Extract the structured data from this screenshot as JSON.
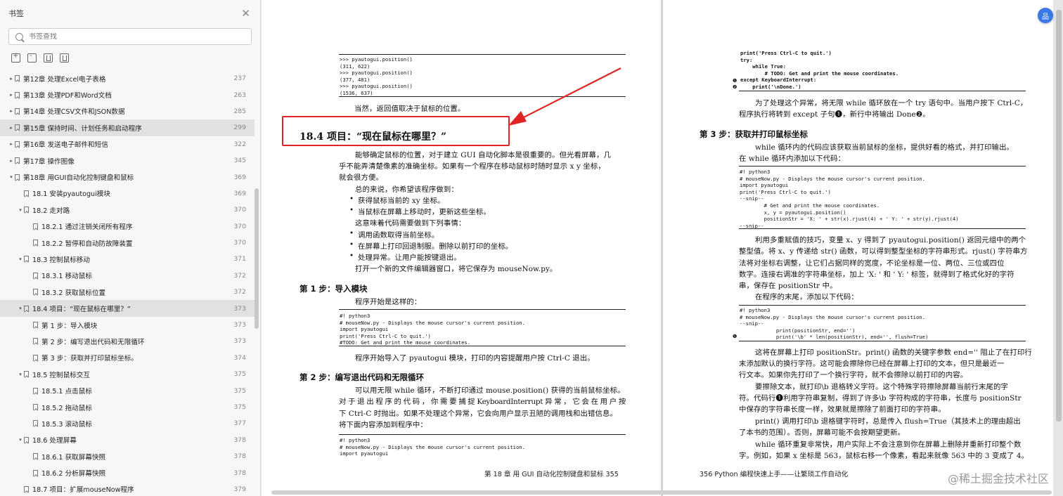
{
  "sidebar": {
    "title": "书签",
    "close_glyph": "✕",
    "search_placeholder": "书签查找",
    "items": [
      {
        "label": "第12章  处理Excel电子表格",
        "page": "237",
        "arrow": "▸"
      },
      {
        "label": "第13章  处理PDF和Word文档",
        "page": "263",
        "arrow": "▸"
      },
      {
        "label": "第14章  处理CSV文件和JSON数据",
        "page": "285",
        "arrow": "▸"
      },
      {
        "label": "第15章  保持时间、计划任务和启动程序",
        "page": "299",
        "arrow": "▸"
      },
      {
        "label": "第16章  发送电子邮件和短信",
        "page": "322",
        "arrow": "▸"
      },
      {
        "label": "第17章  操作图像",
        "page": "345",
        "arrow": "▸"
      },
      {
        "label": "第18章  用GUI自动化控制键盘和鼠标",
        "page": "369",
        "arrow": "▾"
      },
      {
        "label": "18.1  安装pyautogui模块",
        "page": "369",
        "arrow": ""
      },
      {
        "label": "18.2  走对路",
        "page": "370",
        "arrow": "▾"
      },
      {
        "label": "18.2.1  通过注销关闭所有程序",
        "page": "370",
        "arrow": ""
      },
      {
        "label": "18.2.2  暂停和自动防故障装置",
        "page": "370",
        "arrow": ""
      },
      {
        "label": "18.3  控制鼠标移动",
        "page": "371",
        "arrow": "▾"
      },
      {
        "label": "18.3.1  移动鼠标",
        "page": "372",
        "arrow": ""
      },
      {
        "label": "18.3.2  获取鼠标位置",
        "page": "372",
        "arrow": ""
      },
      {
        "label": "18.4  项目：“现在鼠标在哪里？”",
        "page": "373",
        "arrow": "▾"
      },
      {
        "label": "第 1 步：导入模块",
        "page": "373",
        "arrow": ""
      },
      {
        "label": "第 2 步：编写退出代码和无限循环",
        "page": "373",
        "arrow": ""
      },
      {
        "label": "第 3 步：获取并打印鼠标坐标。",
        "page": "374",
        "arrow": ""
      },
      {
        "label": "18.5  控制鼠标交互",
        "page": "375",
        "arrow": "▾"
      },
      {
        "label": "18.5.1  点击鼠标",
        "page": "375",
        "arrow": ""
      },
      {
        "label": "18.5.2  拖动鼠标",
        "page": "375",
        "arrow": ""
      },
      {
        "label": "18.5.3  滚动鼠标",
        "page": "377",
        "arrow": ""
      },
      {
        "label": "18.6  处理屏幕",
        "page": "378",
        "arrow": "▾"
      },
      {
        "label": "18.6.1  获取屏幕快照",
        "page": "378",
        "arrow": ""
      },
      {
        "label": "18.6.2  分析屏幕快照",
        "page": "378",
        "arrow": ""
      },
      {
        "label": "18.7  项目：扩展mouseNow程序",
        "page": "379",
        "arrow": ""
      }
    ]
  },
  "left_page": {
    "code1": ">>> pyautogui.position()\n(311, 622)\n>>> pyautogui.position()\n(377, 481)\n>>> pyautogui.position()\n(1536, 637)",
    "p1": "当然，返回值取决于鼠标的位置。",
    "section": "18.4    项目：“现在鼠标在哪里？”",
    "p2a": "能够确定鼠标的位置，对于建立 GUI 自动化脚本是很重要的。但光看屏幕，几",
    "p2b": "乎不能弄清楚像素的准确坐标。如果有一个程序在移动鼠标时随时显示 x y 坐标，",
    "p2c": "就会很方便。",
    "p3": "总的来说，你希望该程序做到：",
    "b1": "获得鼠标当前的 xy 坐标。",
    "b2": "当鼠标在屏幕上移动时，更新这些坐标。",
    "p4": "这意味着代码需要做到下列事情：",
    "b3": "调用函数取得当前坐标。",
    "b4": "在屏幕上打印回退制服。删除以前打印的坐标。",
    "b5": "处理异常。让用户能按键退出。",
    "p5": "打开一个新的文件编辑器窗口，将它保存为 mouseNow.py。",
    "step1": "第 1 步：导入模块",
    "p6": "程序开始是这样的：",
    "code2": "#! python3\n# mouseNow.py - Displays the mouse cursor's current position.\nimport pyautogui\nprint('Press Ctrl-C to quit.')\n#TODO: Get and print the mouse coordinates.",
    "p7": "程序开始导入了 pyautogui 模块，打印的内容提醒用户按 Ctrl-C 退出。",
    "step2": "第 2 步：编写退出代码和无限循环",
    "p8a": "可以用无限 while 循环，不断打印通过 mouse.position() 获得的当前鼠标坐标。",
    "p8b": "对 于 退 出 程 序 的 代 码 ， 你 需 要 捕 捉 KeyboardInterrupt  异 常 ， 它 会 在 用 户 按",
    "p8c": "下 Ctrl-C 时抛出。如果不处理这个异常，它会向用户显示丑陋的调用栈和出错信息。",
    "p8d": "将下面内容添加到程序中：",
    "code3": "#! python3\n# mouseNow.py - Displays the mouse cursor's current position.\nimport pyautogui",
    "footer": "第 18 章    用 GUI 自动化控制键盘和鼠标    355"
  },
  "right_page": {
    "code1": "print('Press Ctrl-C to quit.')\ntry:\n    while True:\n        # TODO: Get and print the mouse coordinates.\nexcept KeyboardInterrupt:\n    print('\\nDone.')",
    "mark1": "❶",
    "mark2": "❷",
    "mark3": "❶",
    "p1a": "为了处理这个异常，将无限 while 循环放在一个 try 语句中。当用户按下 Ctrl-C，",
    "p1b": "程序执行将转到 except 子句❶，新行中将输出 Done❷。",
    "step3": "第 3 步：获取并打印鼠标坐标",
    "p2a": "while 循环内的代码应该获取当前鼠标的坐标，提供好看的格式，并打印输出。",
    "p2b": "在 while 循环内添加以下代码：",
    "code2": "#! python3\n# mouseNow.py - Displays the mouse cursor's current position.\nimport pyautogui\nprint('Press Ctrl-C to quit.')\n--snip--\n        # Get and print the mouse coordinates.\n        x, y = pyautogui.position()\n        positionStr = 'X: ' + str(x).rjust(4) + ' Y: ' + str(y).rjust(4)\n--snip--",
    "p3a": "利用多重赋值的技巧，变量 x、y 得到了 pyautogui.position() 返回元组中的两个",
    "p3b": "整型值。将 x、y 传递给 str() 函数，可以得到整型坐标的字符串形式。rjust() 字符串方",
    "p3c": "法将对坐标右调整，让它们占据同样的宽度，不论坐标是一位、两位、三位或四位",
    "p3d": "数字。连接右调准的字符串坐标，加上 'X: ' 和 ' Y: ' 标签，就得到了格式化好的字符",
    "p3e": "串，保存在 positionStr 中。",
    "p4": "在程序的末尾，添加以下代码：",
    "code3": "#! python3\n# mouseNow.py - Displays the mouse cursor's current position.\n--snip--\n            print(positionStr, end='')\n            print('\\b' * len(positionStr), end='', flush=True)",
    "p5a": "这将在屏幕上打印 positionStr。print() 函数的关键字参数 end='' 阻止了在打印行",
    "p5b": "末添加默认的换行字符。这可能会擦除你已经在屏幕上打印的文本，但只是最近一",
    "p5c": "行文本。如果你先打印了一个换行字符，就不会擦除以前打印的内容。",
    "p6a": "要擦除文本，就打印\\b 退格转义字符。这个特殊字符擦除屏幕当前行末尾的字",
    "p6b": "符。代码行❶利用字符串复制，得到了许多\\b 字符构成的字符串，长度与 positionStr",
    "p6c": "中保存的字符串长度一样，效果就是擦除了前面打印的字符串。",
    "p7a": "print() 调用打印\\b 退格键字符时，总是传入 flush=True（其技术上的理由超出",
    "p7b": "了本书的范围）。否则，屏幕可能不会按期望更新。",
    "p8a": "while 循环重复非常快，用户实际上不会注意到你在屏幕上删除并重新打印整个数",
    "p8b": "字。例如，如果 x 坐标是 563，鼠标右移一个像素，看起来就像 563 中的 3 变成了 4。",
    "footer": "356    Python 编程快速上手——让繁琐工作自动化"
  },
  "fab_label": "品",
  "watermark": "@稀土掘金技术社区",
  "colors": {
    "highlight": "#e02424",
    "accent": "#3a78e6"
  }
}
